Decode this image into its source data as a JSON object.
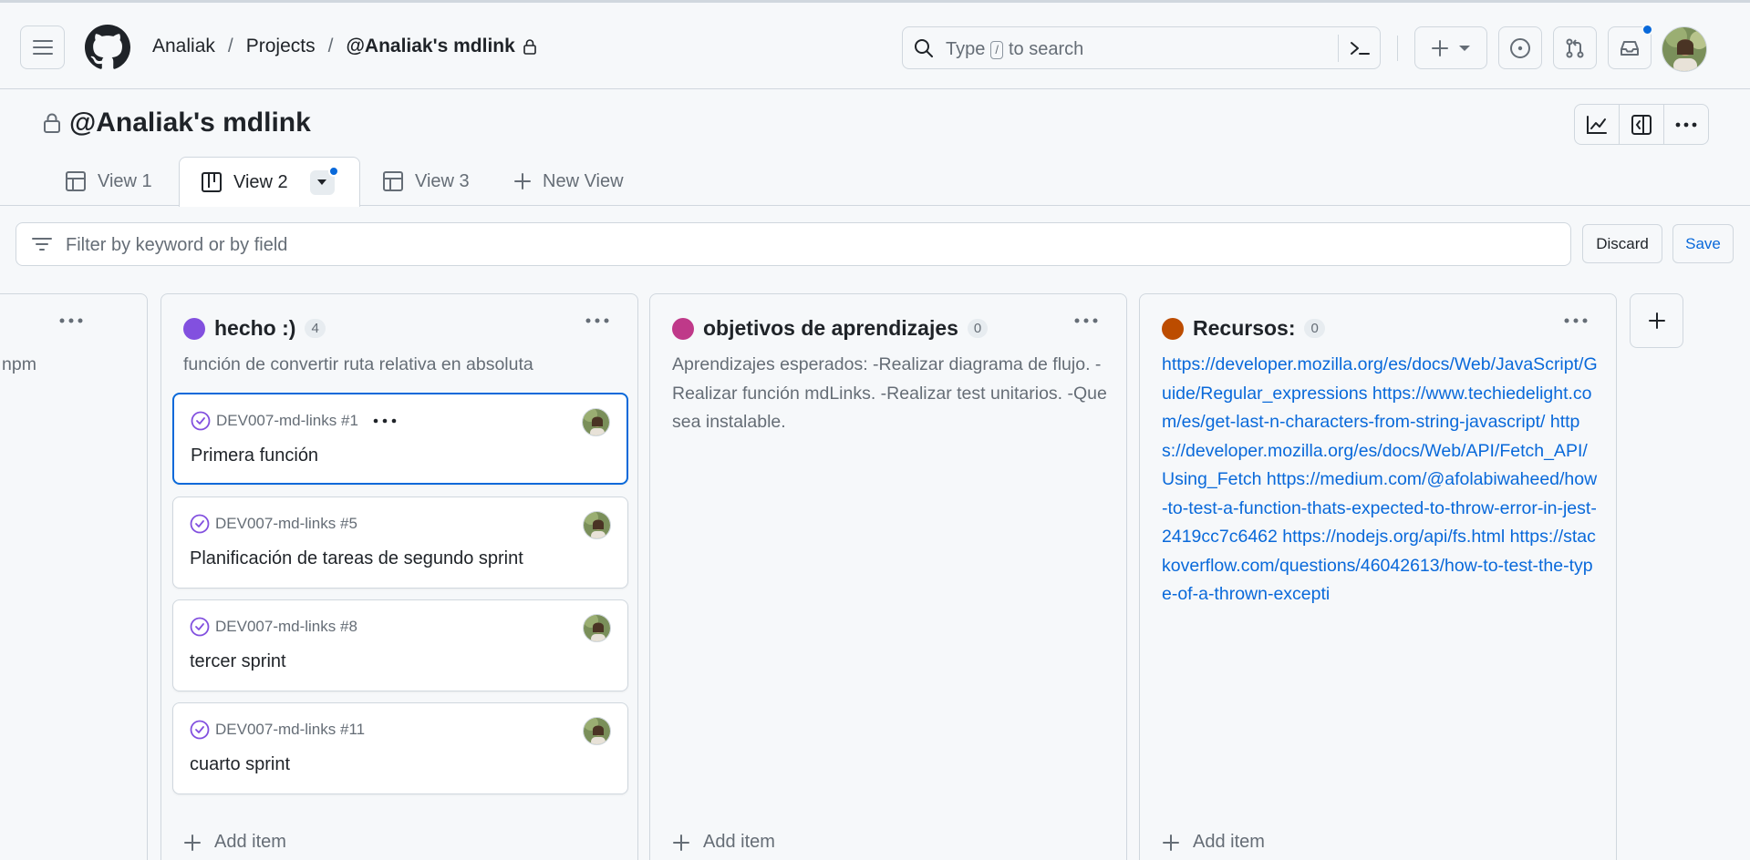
{
  "header": {
    "breadcrumbs": [
      "Analiak",
      "Projects",
      "@Analiak's mdlink"
    ],
    "search": {
      "before": "Type",
      "key": "/",
      "after": "to search"
    },
    "icons": [
      "hamburger-icon",
      "github-logo",
      "search-icon",
      "command-palette-icon",
      "plus-icon",
      "chevron-down-icon",
      "issue-icon",
      "pull-request-icon",
      "inbox-icon"
    ]
  },
  "project": {
    "title": "@Analiak's mdlink",
    "actions": [
      "graph-icon",
      "side-panel-icon",
      "kebab-icon"
    ]
  },
  "tabs": [
    {
      "label": "View 1",
      "icon": "table-icon"
    },
    {
      "label": "View 2",
      "icon": "board-icon",
      "active": true
    },
    {
      "label": "View 3",
      "icon": "table-icon"
    },
    {
      "label": "New View",
      "icon": "plus-icon"
    }
  ],
  "filter": {
    "placeholder": "Filter by keyword or by field",
    "discard": "Discard",
    "save": "Save"
  },
  "columns": [
    {
      "partial_desc": "npm"
    },
    {
      "name": "hecho :)",
      "count": "4",
      "color": "#8250df",
      "description": "función de convertir ruta relativa en absoluta",
      "cards": [
        {
          "ref": "DEV007-md-links #1",
          "title": "Primera función"
        },
        {
          "ref": "DEV007-md-links #5",
          "title": "Planificación de tareas de segundo sprint"
        },
        {
          "ref": "DEV007-md-links #8",
          "title": "tercer sprint"
        },
        {
          "ref": "DEV007-md-links #11",
          "title": "cuarto sprint"
        }
      ],
      "add_item": "Add item"
    },
    {
      "name": "objetivos de aprendizajes",
      "count": "0",
      "color": "#bf3989",
      "description": "Aprendizajes esperados: -Realizar diagrama de flujo. -Realizar función mdLinks. -Realizar test unitarios. -Que sea instalable.",
      "add_item": "Add item"
    },
    {
      "name": "Recursos:",
      "count": "0",
      "color": "#bc4c00",
      "links": [
        "https://developer.mozilla.org/es/docs/Web/JavaScript/Guide/Regular_expressions",
        "https://www.techiedelight.com/es/get-last-n-characters-from-string-javascript/",
        "https://developer.mozilla.org/es/docs/Web/API/Fetch_API/Using_Fetch",
        "https://medium.com/@afolabiwaheed/how-to-test-a-function-thats-expected-to-throw-error-in-jest-2419cc7c6462",
        "https://nodejs.org/api/fs.html",
        "https://stackoverflow.com/questions/46042613/how-to-test-the-type-of-a-thrown-excepti"
      ],
      "add_item": "Add item"
    }
  ]
}
